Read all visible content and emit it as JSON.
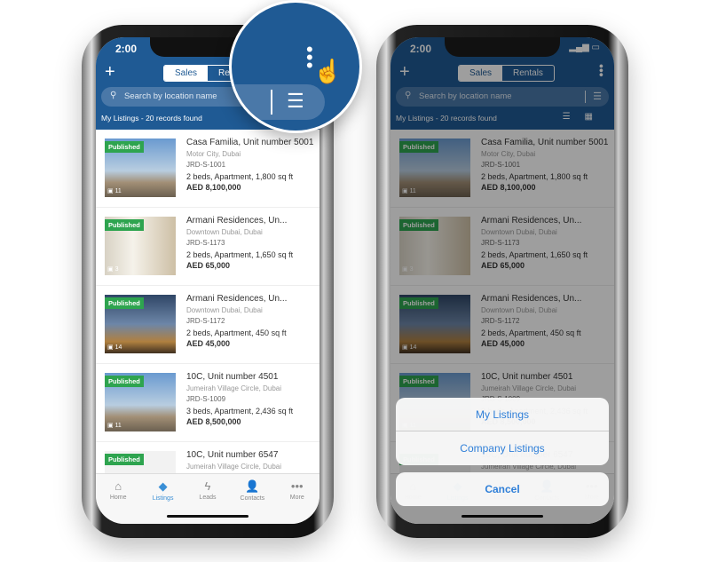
{
  "status": {
    "time": "2:00"
  },
  "header": {
    "add": "+",
    "tabs": [
      "Sales",
      "Rentals"
    ],
    "search_placeholder": "Search by location name",
    "count": "My Listings - 20 records found"
  },
  "listings": [
    {
      "badge": "Published",
      "title": "Casa Familia, Unit number 5001",
      "location": "Motor City, Dubai",
      "ref": "JRD-S-1001",
      "details": "2 beds, Apartment, 1,800 sq ft",
      "price": "AED 8,100,000",
      "photos": "11",
      "img": "city"
    },
    {
      "badge": "Published",
      "title": "Armani Residences, Un...",
      "location": "Downtown Dubai, Dubai",
      "ref": "JRD-S-1173",
      "details": "2 beds, Apartment, 1,650 sq ft",
      "price": "AED 65,000",
      "photos": "3",
      "img": "int"
    },
    {
      "badge": "Published",
      "title": "Armani Residences, Un...",
      "location": "Downtown Dubai, Dubai",
      "ref": "JRD-S-1172",
      "details": "2 beds, Apartment, 450 sq ft",
      "price": "AED 45,000",
      "photos": "14",
      "img": "night"
    },
    {
      "badge": "Published",
      "title": "10C, Unit number 4501",
      "location": "Jumeirah Village Circle, Dubai",
      "ref": "JRD-S-1009",
      "details": "3 beds, Apartment, 2,436 sq ft",
      "price": "AED 8,500,000",
      "photos": "11",
      "img": "city"
    },
    {
      "badge": "Published",
      "title": "10C, Unit number 6547",
      "location": "Jumeirah Village Circle, Dubai",
      "ref": "",
      "details": "",
      "price": "",
      "photos": "",
      "img": "blank"
    }
  ],
  "tabbar": [
    {
      "label": "Home",
      "icon": "home-icon",
      "g": "⌂"
    },
    {
      "label": "Listings",
      "icon": "layers-icon",
      "g": "◆"
    },
    {
      "label": "Leads",
      "icon": "bolt-icon",
      "g": "ϟ"
    },
    {
      "label": "Contacts",
      "icon": "person-icon",
      "g": "👤"
    },
    {
      "label": "More",
      "icon": "more-icon",
      "g": "•••"
    }
  ],
  "active_tab": "Listings",
  "action_sheet": {
    "options": [
      "My Listings",
      "Company Listings"
    ],
    "cancel": "Cancel"
  },
  "colors": {
    "header": "#1f5a94",
    "badge": "#2ea44f",
    "accent": "#3a8fd6"
  }
}
